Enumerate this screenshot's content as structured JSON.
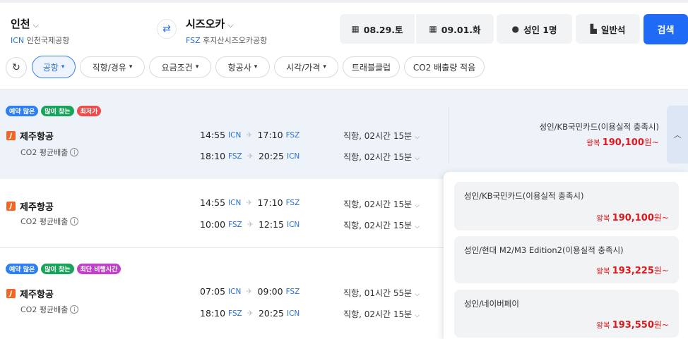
{
  "search": {
    "origin": {
      "name": "인천",
      "code": "ICN",
      "airport": "인천국제공항"
    },
    "swap_icon": "swap-icon",
    "destination": {
      "name": "시즈오카",
      "code": "FSZ",
      "airport": "후지산시즈오카공항"
    },
    "depart_date": "08.29.토",
    "return_date": "09.01.화",
    "passengers": "성인 1명",
    "cabin": "일반석",
    "search_label": "검색"
  },
  "filters": {
    "refresh_icon": "refresh-icon",
    "chips": [
      "공항",
      "직항/경유",
      "요금조건",
      "항공사",
      "시각/가격",
      "트래블클럽",
      "CO2 배출량 적음"
    ]
  },
  "badges": {
    "popular_booking": "예약 많은",
    "popular_search": "많이 찾는",
    "lowest_price": "최저가",
    "shortest_time": "최단 비행시간"
  },
  "results": [
    {
      "airline": "제주항공",
      "co2_label": "CO2 평균배출",
      "outbound": {
        "dep_time": "14:55",
        "dep_code": "ICN",
        "arr_time": "17:10",
        "arr_code": "FSZ",
        "duration": "직항, 02시간 15분"
      },
      "inbound": {
        "dep_time": "18:10",
        "dep_code": "FSZ",
        "arr_time": "20:25",
        "arr_code": "ICN",
        "duration": "직항, 02시간 15분"
      },
      "price_label": "성인/KB국민카드(이용실적 충족시)",
      "price_prefix": "왕복",
      "price": "190,100",
      "price_unit": "원~"
    },
    {
      "airline": "제주항공",
      "co2_label": "CO2 평균배출",
      "outbound": {
        "dep_time": "14:55",
        "dep_code": "ICN",
        "arr_time": "17:10",
        "arr_code": "FSZ",
        "duration": "직항, 02시간 15분"
      },
      "inbound": {
        "dep_time": "10:00",
        "dep_code": "FSZ",
        "arr_time": "12:15",
        "arr_code": "ICN",
        "duration": "직항, 02시간 15분"
      }
    },
    {
      "airline": "제주항공",
      "co2_label": "CO2 평균배출",
      "outbound": {
        "dep_time": "07:05",
        "dep_code": "ICN",
        "arr_time": "09:00",
        "arr_code": "FSZ",
        "duration": "직항, 01시간 55분"
      },
      "inbound": {
        "dep_time": "18:10",
        "dep_code": "FSZ",
        "arr_time": "20:25",
        "arr_code": "ICN",
        "duration": "직항, 02시간 15분"
      }
    }
  ],
  "fare_options": [
    {
      "label": "성인/KB국민카드(이용실적 충족시)",
      "prefix": "왕복",
      "price": "190,100",
      "unit": "원~"
    },
    {
      "label": "성인/현대 M2/M3 Edition2(이용실적 충족시)",
      "prefix": "왕복",
      "price": "193,225",
      "unit": "원~"
    },
    {
      "label": "성인/네이버페이",
      "prefix": "왕복",
      "price": "193,550",
      "unit": "원~"
    }
  ],
  "colors": {
    "accent": "#1f6bf5",
    "price": "#e0181b",
    "airline_logo": "#f26522"
  }
}
